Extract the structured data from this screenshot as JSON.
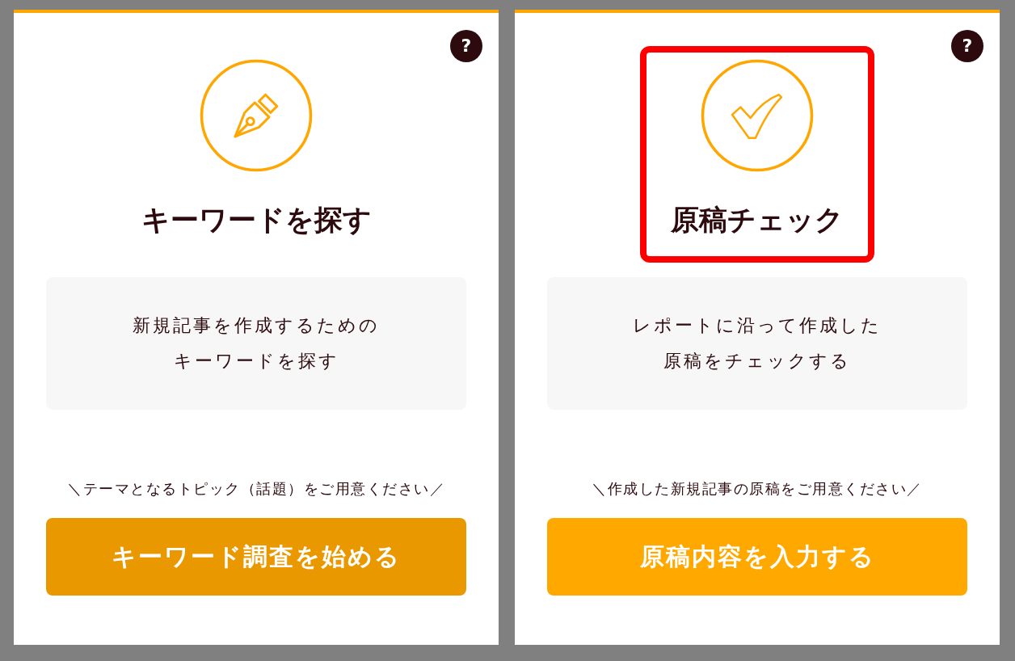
{
  "cards": [
    {
      "help": "?",
      "highlighted": false,
      "title": "キーワードを探す",
      "description": [
        "新規記事を作成するための",
        "キーワードを探す"
      ],
      "hint": "＼テーマとなるトピック（話題）をご用意ください／",
      "button": {
        "label": "キーワード調査を始める",
        "hovered": true
      }
    },
    {
      "help": "?",
      "highlighted": true,
      "title": "原稿チェック",
      "description": [
        "レポートに沿って作成した",
        "原稿をチェックする"
      ],
      "hint": "＼作成した新規記事の原稿をご用意ください／",
      "button": {
        "label": "原稿内容を入力する",
        "hovered": false
      }
    }
  ]
}
